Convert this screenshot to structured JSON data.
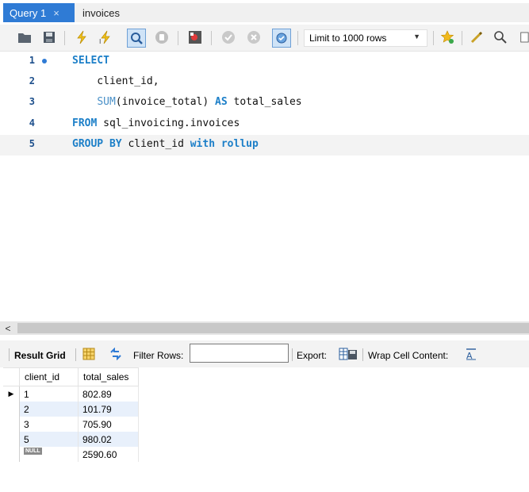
{
  "tabs": [
    {
      "label": "Query 1",
      "active": true,
      "close": "×"
    },
    {
      "label": "invoices",
      "active": false
    }
  ],
  "toolbar": {
    "icons": [
      "folder-open-icon",
      "save-icon",
      "execute-icon",
      "execute-current-icon",
      "explain-icon",
      "stop-icon",
      "toggle-error-icon",
      "commit-icon",
      "rollback-icon",
      "autocommit-icon",
      "star-icon",
      "beautify-icon",
      "search-icon"
    ],
    "limit_label": "Limit to 1000 rows",
    "accent": "#2f7bd5"
  },
  "editor": {
    "lines": [
      {
        "num": "1",
        "tokens": [
          {
            "t": "SELECT",
            "k": "kw"
          }
        ]
      },
      {
        "num": "2",
        "tokens": [
          {
            "t": "    client_id,",
            "k": "tx"
          }
        ]
      },
      {
        "num": "3",
        "tokens": [
          {
            "t": "    ",
            "k": "tx"
          },
          {
            "t": "SUM",
            "k": "fn"
          },
          {
            "t": "(invoice_total) ",
            "k": "tx"
          },
          {
            "t": "AS",
            "k": "kw"
          },
          {
            "t": " total_sales",
            "k": "tx"
          }
        ]
      },
      {
        "num": "4",
        "tokens": [
          {
            "t": "FROM",
            "k": "kw"
          },
          {
            "t": " sql_invoicing.invoices",
            "k": "tx"
          }
        ]
      },
      {
        "num": "5",
        "tokens": [
          {
            "t": "GROUP BY",
            "k": "kw"
          },
          {
            "t": " client_id ",
            "k": "tx"
          },
          {
            "t": "with rollup",
            "k": "kw"
          }
        ]
      }
    ]
  },
  "scroll": {
    "left_arrow": "<"
  },
  "result_toolbar": {
    "result_grid": "Result Grid",
    "filter_rows": "Filter Rows:",
    "filter_value": "",
    "export": "Export:",
    "wrap": "Wrap Cell Content:"
  },
  "grid": {
    "columns": [
      "client_id",
      "total_sales"
    ],
    "rows": [
      {
        "client_id": "1",
        "total_sales": "802.89"
      },
      {
        "client_id": "2",
        "total_sales": "101.79"
      },
      {
        "client_id": "3",
        "total_sales": "705.90"
      },
      {
        "client_id": "5",
        "total_sales": "980.02"
      },
      {
        "client_id": "NULL",
        "total_sales": "2590.60"
      }
    ],
    "row_indicator": "▶"
  }
}
